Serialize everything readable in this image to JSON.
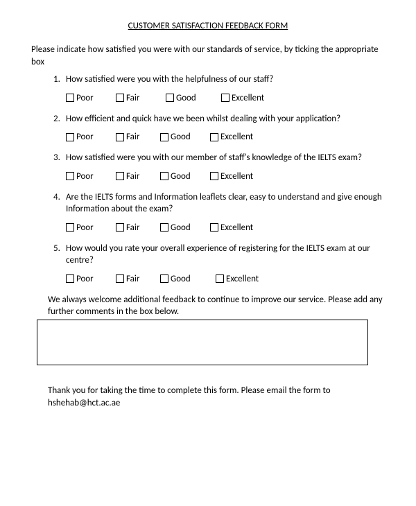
{
  "title": "CUSTOMER SATISFACTION FEEDBACK FORM",
  "intro": "Please indicate how satisfied you were with our standards of service, by ticking the appropriate box",
  "questions": [
    {
      "num": "1.",
      "text": "How satisfied were you with the helpfulness of our staff?",
      "options": [
        "Poor",
        "Fair",
        "Good",
        "Excellent"
      ]
    },
    {
      "num": "2.",
      "text": "How efficient and quick have we been whilst dealing with your application?",
      "options": [
        "Poor",
        "Fair",
        "Good",
        "Excellent"
      ]
    },
    {
      "num": "3.",
      "text": "How satisfied were you with our member of staff's knowledge of the IELTS exam?",
      "options": [
        "Poor",
        "Fair",
        "Good",
        "Excellent"
      ]
    },
    {
      "num": "4.",
      "text": "Are the IELTS forms and Information leaflets clear, easy to understand and give enough Information about the exam?",
      "options": [
        "Poor",
        "Fair",
        "Good",
        "Excellent"
      ]
    },
    {
      "num": "5.",
      "text": "How would you rate your overall experience of registering for the IELTS exam at our centre?",
      "options": [
        "Poor",
        "Fair",
        "Good",
        "Excellent"
      ]
    }
  ],
  "feedback_intro": "We always welcome additional feedback to continue to improve our service. Please add any further comments  in the box below.",
  "thankyou": "Thank you for taking the time to complete this form. Please email the form to hshehab@hct.ac.ae"
}
